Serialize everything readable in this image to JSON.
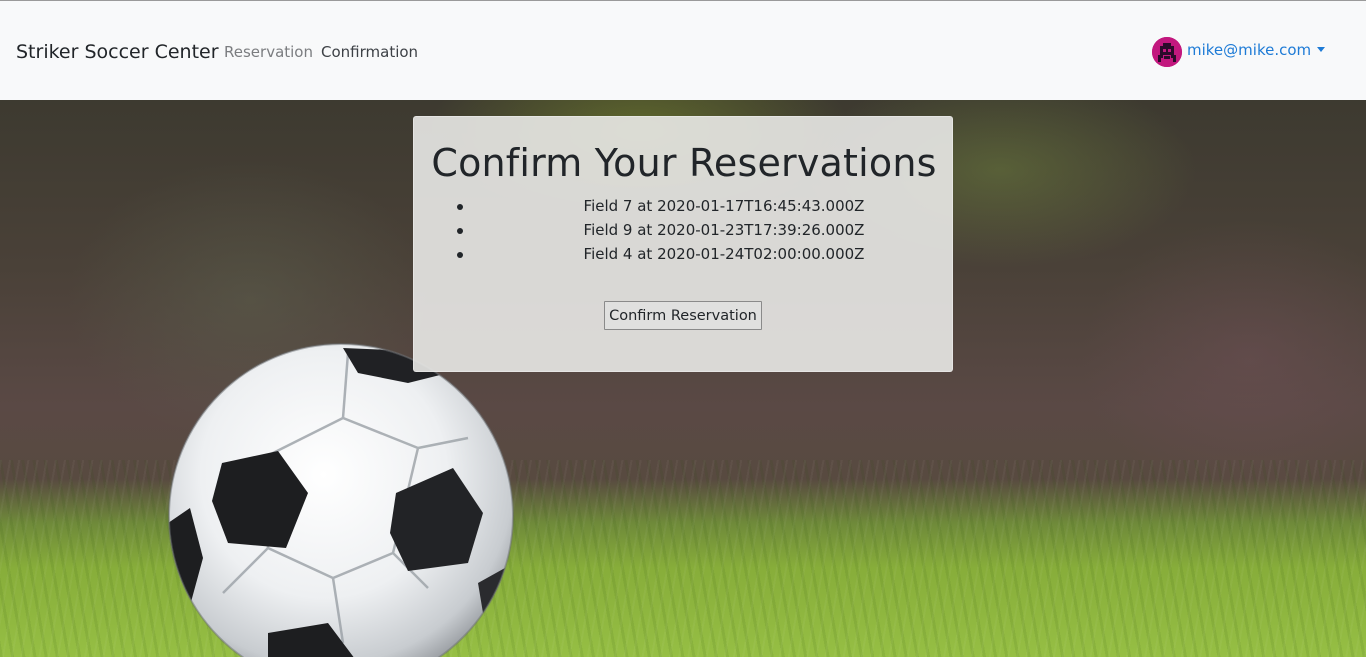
{
  "navbar": {
    "brand": "Striker Soccer Center",
    "links": [
      "Reservation",
      "Confirmation"
    ],
    "user": {
      "email": "mike@mike.com",
      "avatar_icon": "pixel-avatar-icon",
      "avatar_color": "#c2187e",
      "link_color": "#1e7bd6"
    }
  },
  "card": {
    "title": "Confirm Your Reservations",
    "reservations": [
      "Field 7 at 2020-01-17T16:45:43.000Z",
      "Field 9 at 2020-01-23T17:39:26.000Z",
      "Field 4 at 2020-01-24T02:00:00.000Z"
    ],
    "button_label": "Confirm Reservation"
  },
  "background": {
    "image": "soccer-ball-on-grass"
  }
}
